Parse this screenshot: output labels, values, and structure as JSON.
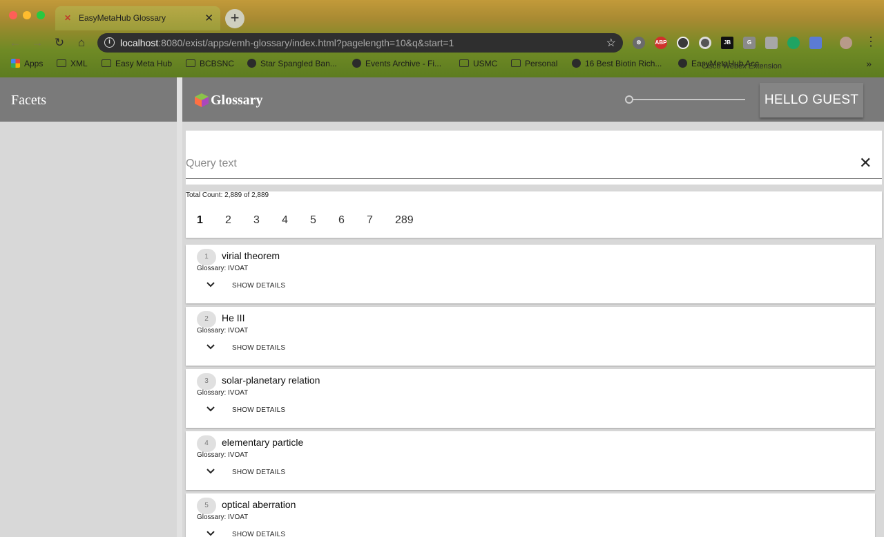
{
  "browser": {
    "tab_title": "EasyMetaHub Glossary",
    "tab_close": "✕",
    "new_tab": "+",
    "url_host": "localhost",
    "url_rest": ":8080/exist/apps/emh-glossary/index.html?pagelength=10&q&start=1",
    "tooltip": "Cisco Webex Extension",
    "bookmarks": [
      "Apps",
      "XML",
      "Easy Meta Hub",
      "BCBSNC",
      "Star Spangled Ban...",
      "Events Archive - Fi...",
      "USMC",
      "Personal",
      "16 Best Biotin Rich...",
      "EasyMetaHub Acc..."
    ],
    "extensions": [
      "ABP",
      "JB",
      "G"
    ],
    "more": "»"
  },
  "app": {
    "facets_title": "Facets",
    "logo_text": "Glossary",
    "user_button": "HELLO GUEST",
    "search": {
      "placeholder": "Query text",
      "clear": "✕"
    },
    "total_count": "Total Count: 2,889 of 2,889",
    "pages": [
      "1",
      "2",
      "3",
      "4",
      "5",
      "6",
      "7",
      "289"
    ],
    "active_page": "1",
    "details_label": "SHOW DETAILS",
    "results": [
      {
        "num": "1",
        "term": "virial theorem",
        "glossary": "Glossary: IVOAT"
      },
      {
        "num": "2",
        "term": "He III",
        "glossary": "Glossary: IVOAT"
      },
      {
        "num": "3",
        "term": "solar-planetary relation",
        "glossary": "Glossary: IVOAT"
      },
      {
        "num": "4",
        "term": "elementary particle",
        "glossary": "Glossary: IVOAT"
      },
      {
        "num": "5",
        "term": "optical aberration",
        "glossary": "Glossary: IVOAT"
      }
    ]
  },
  "colors": {
    "header_gray": "#7a7a7a",
    "page_bg": "#d8d8d8",
    "card_bg": "#ffffff"
  }
}
